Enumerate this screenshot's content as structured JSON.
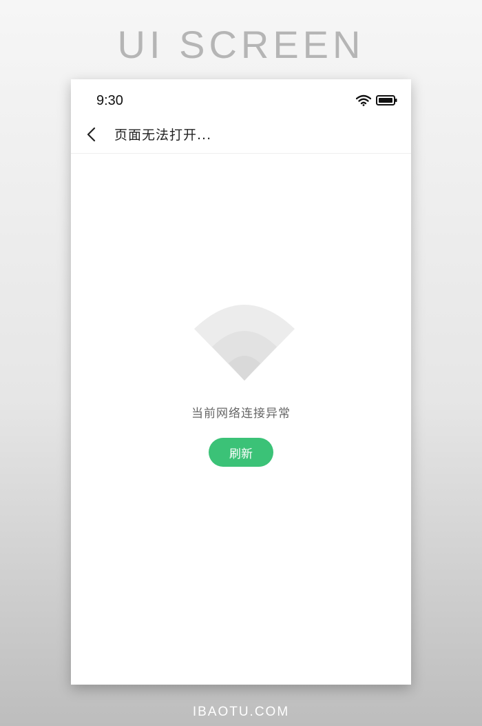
{
  "banner": {
    "title": "UI SCREEN",
    "footer": "IBAOTU.COM"
  },
  "status_bar": {
    "time": "9:30",
    "icons": [
      "wifi-icon",
      "battery-icon"
    ]
  },
  "nav": {
    "back_icon": "chevron-left-icon",
    "title": "页面无法打开..."
  },
  "empty_state": {
    "illustration_icon": "wifi-signal-icon",
    "message": "当前网络连接异常",
    "refresh_label": "刷新"
  },
  "colors": {
    "accent": "#3bc277",
    "illustration": "#e4e4e4"
  }
}
